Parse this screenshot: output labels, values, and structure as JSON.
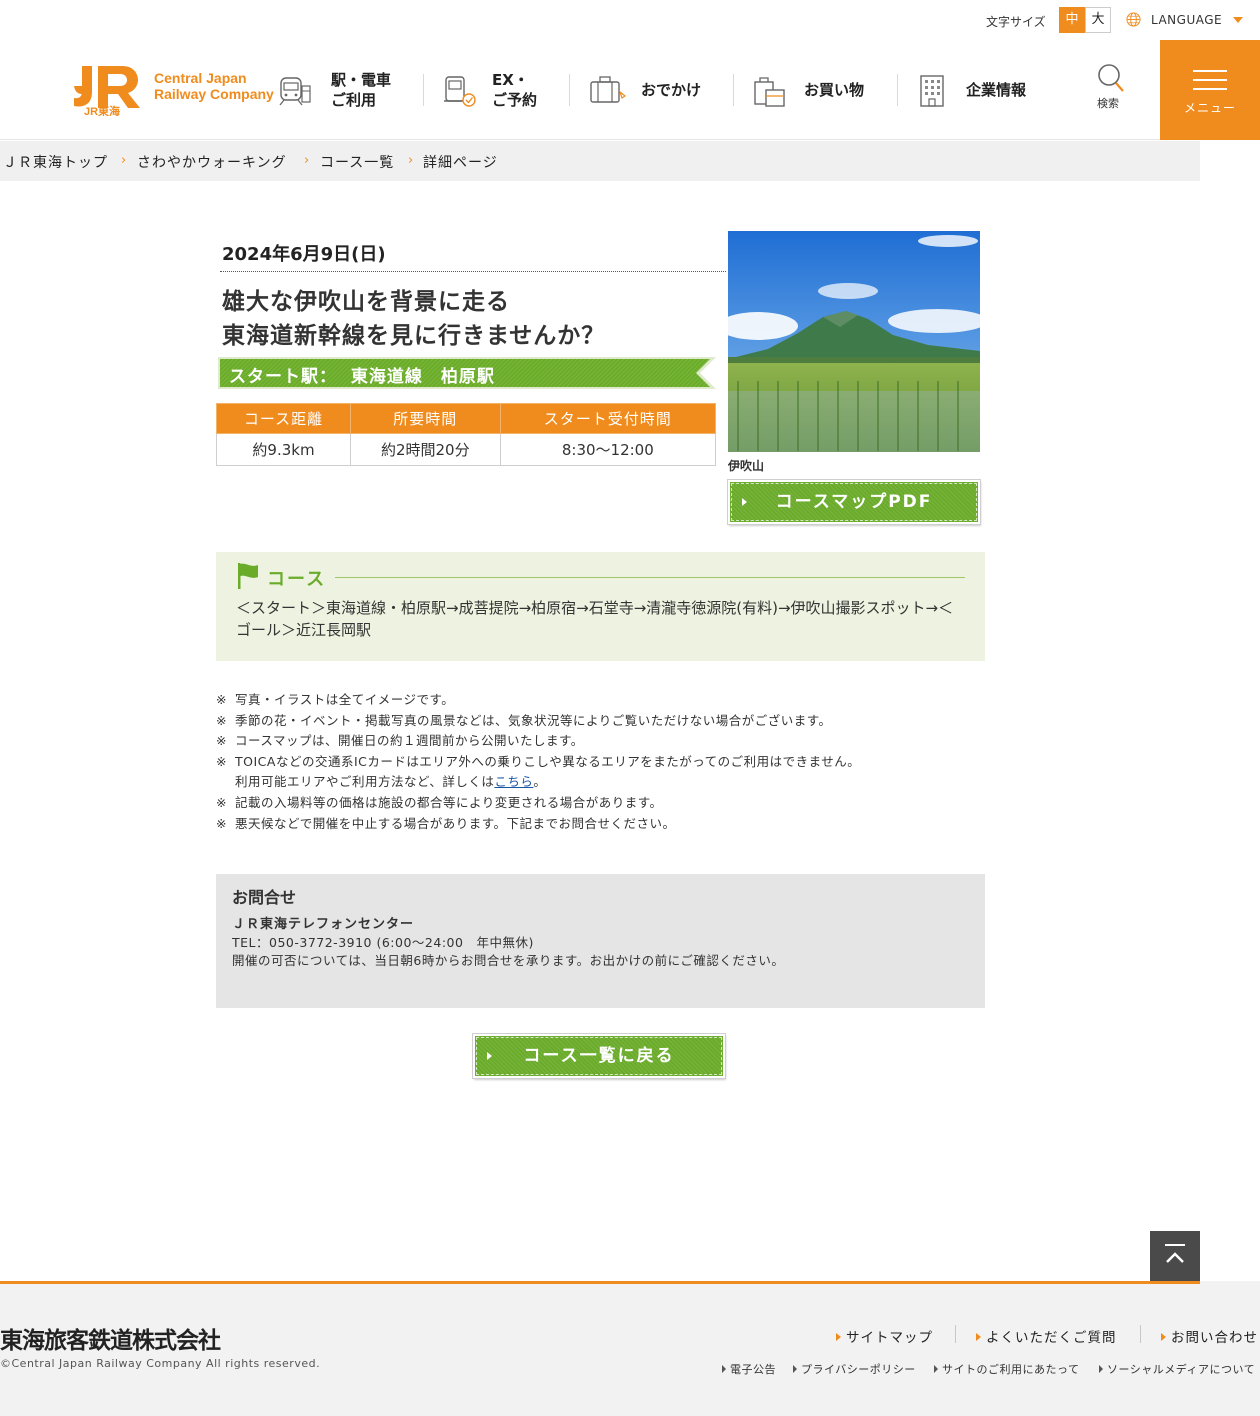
{
  "utility": {
    "font_size_label": "文字サイズ",
    "font_size_medium": "中",
    "font_size_large": "大",
    "language_label": "LANGUAGE"
  },
  "header": {
    "logo_mark": "JR",
    "logo_sub": "JR東海",
    "logo_line1": "Central Japan",
    "logo_line2": "Railway Company",
    "nav": [
      {
        "label": "駅・電車\nご利用",
        "icon": "train-icon"
      },
      {
        "label": "EX・\nご予約",
        "icon": "ticket-reservation-icon"
      },
      {
        "label": "おでかけ",
        "icon": "suitcase-icon"
      },
      {
        "label": "お買い物",
        "icon": "shopping-bag-icon"
      },
      {
        "label": "企業情報",
        "icon": "building-icon"
      }
    ],
    "search_label": "検索",
    "menu_label": "メニュー"
  },
  "breadcrumb": [
    "ＪＲ東海トップ",
    "さわやかウォーキング",
    "コース一覧",
    "詳細ページ"
  ],
  "event": {
    "date": "2024年6月9日(日)",
    "title_line1": "雄大な伊吹山を背景に走る",
    "title_line2": "東海道新幹線を見に行きませんか？",
    "start_station": "スタート駅：  東海道線　柏原駅",
    "table_headers": [
      "コース距離",
      "所要時間",
      "スタート受付時間"
    ],
    "table_values": [
      "約9.3km",
      "約2時間20分",
      "8:30〜12:00"
    ],
    "photo_caption": "伊吹山",
    "pdf_button": "コースマップPDF"
  },
  "course": {
    "heading": "コース",
    "route": "＜スタート＞東海道線・柏原駅→成菩提院→柏原宿→石堂寺→清瀧寺徳源院(有料)→伊吹山撮影スポット→＜ゴール＞近江長岡駅"
  },
  "notes": {
    "mark": "※",
    "items": [
      "写真・イラストは全てイメージです。",
      "季節の花・イベント・掲載写真の風景などは、気象状況等によりご覧いただけない場合がございます。",
      "コースマップは、開催日の約１週間前から公開いたします。",
      "TOICAなどの交通系ICカードはエリア外への乗りこしや異なるエリアをまたがってのご利用はできません。"
    ],
    "toica_cont_prefix": "利用可能エリアやご利用方法など、詳しくは",
    "toica_link": "こちら",
    "toica_cont_suffix": "。",
    "items_after": [
      "記載の入場料等の価格は施設の都合等により変更される場合があります。",
      "悪天候などで開催を中止する場合があります。下記までお問合せください。"
    ]
  },
  "contact": {
    "title": "お問合せ",
    "name": "ＪＲ東海テレフォンセンター",
    "tel": "TEL：050-3772-3910 (6:00〜24:00　年中無休)",
    "note": "開催の可否については、当日朝6時からお問合せを承ります。お出かけの前にご確認ください。"
  },
  "back_button": "コース一覧に戻る",
  "footer": {
    "company": "東海旅客鉄道株式会社",
    "copyright": "©Central Japan Railway Company All rights reserved.",
    "links_main": [
      "サイトマップ",
      "よくいただくご質問",
      "お問い合わせ"
    ],
    "links_sub": [
      "電子公告",
      "プライバシーポリシー",
      "サイトのご利用にあたって",
      "ソーシャルメディアについて"
    ]
  },
  "colors": {
    "brand_orange": "#f08c1e",
    "green": "#6aab2a",
    "course_bg": "#eef3e1"
  }
}
